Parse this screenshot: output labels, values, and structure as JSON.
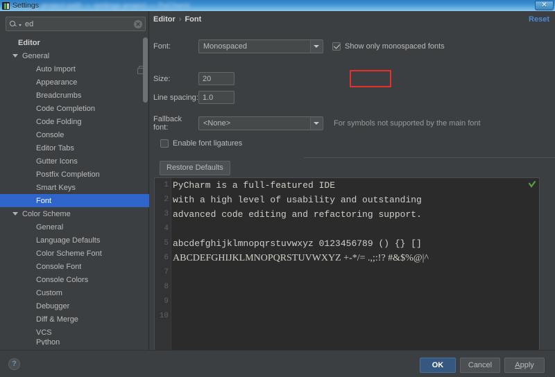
{
  "window": {
    "title": "Settings",
    "title_extra": "project path — settings project — PyCharm",
    "close_label": "✕",
    "icon": "pycharm-icon"
  },
  "sidebar": {
    "search": {
      "value": "ed",
      "placeholder": "",
      "clear_label": "✕"
    },
    "tree": [
      {
        "label": "Editor",
        "level": 0,
        "expander": false,
        "selected": false,
        "badge": false
      },
      {
        "label": "General",
        "level": 1,
        "expander": true,
        "selected": false,
        "badge": false
      },
      {
        "label": "Auto Import",
        "level": 2,
        "expander": false,
        "selected": false,
        "badge": true
      },
      {
        "label": "Appearance",
        "level": 2,
        "expander": false,
        "selected": false,
        "badge": false
      },
      {
        "label": "Breadcrumbs",
        "level": 2,
        "expander": false,
        "selected": false,
        "badge": false
      },
      {
        "label": "Code Completion",
        "level": 2,
        "expander": false,
        "selected": false,
        "badge": false
      },
      {
        "label": "Code Folding",
        "level": 2,
        "expander": false,
        "selected": false,
        "badge": false
      },
      {
        "label": "Console",
        "level": 2,
        "expander": false,
        "selected": false,
        "badge": false
      },
      {
        "label": "Editor Tabs",
        "level": 2,
        "expander": false,
        "selected": false,
        "badge": false
      },
      {
        "label": "Gutter Icons",
        "level": 2,
        "expander": false,
        "selected": false,
        "badge": false
      },
      {
        "label": "Postfix Completion",
        "level": 2,
        "expander": false,
        "selected": false,
        "badge": false
      },
      {
        "label": "Smart Keys",
        "level": 2,
        "expander": false,
        "selected": false,
        "badge": false
      },
      {
        "label": "Font",
        "level": 2,
        "expander": false,
        "selected": true,
        "badge": false
      },
      {
        "label": "Color Scheme",
        "level": 1,
        "expander": true,
        "selected": false,
        "badge": false
      },
      {
        "label": "General",
        "level": 2,
        "expander": false,
        "selected": false,
        "badge": false
      },
      {
        "label": "Language Defaults",
        "level": 2,
        "expander": false,
        "selected": false,
        "badge": false
      },
      {
        "label": "Color Scheme Font",
        "level": 2,
        "expander": false,
        "selected": false,
        "badge": false
      },
      {
        "label": "Console Font",
        "level": 2,
        "expander": false,
        "selected": false,
        "badge": false
      },
      {
        "label": "Console Colors",
        "level": 2,
        "expander": false,
        "selected": false,
        "badge": false
      },
      {
        "label": "Custom",
        "level": 2,
        "expander": false,
        "selected": false,
        "badge": false
      },
      {
        "label": "Debugger",
        "level": 2,
        "expander": false,
        "selected": false,
        "badge": false
      },
      {
        "label": "Diff & Merge",
        "level": 2,
        "expander": false,
        "selected": false,
        "badge": false
      },
      {
        "label": "VCS",
        "level": 2,
        "expander": false,
        "selected": false,
        "badge": false
      },
      {
        "label": "Python",
        "level": 2,
        "expander": false,
        "selected": false,
        "badge": false
      }
    ]
  },
  "main": {
    "breadcrumb": {
      "parent": "Editor",
      "separator": "›",
      "current": "Font"
    },
    "reset_label": "Reset",
    "font": {
      "label": "Font:",
      "value": "Monospaced",
      "monospaced_checkbox_label": "Show only monospaced fonts",
      "monospaced_checked": true
    },
    "size": {
      "label": "Size:",
      "value": "20",
      "highlight_color": "#e8302a"
    },
    "line_spacing": {
      "label": "Line spacing:",
      "value": "1.0"
    },
    "fallback": {
      "label": "Fallback font:",
      "value": "<None>",
      "hint": "For symbols not supported by the main font"
    },
    "ligatures": {
      "label": "Enable font ligatures",
      "checked": false
    },
    "restore_defaults_label": "Restore Defaults",
    "preview": {
      "line_numbers": [
        "1",
        "2",
        "3",
        "4",
        "5",
        "6",
        "7",
        "8",
        "9",
        "10"
      ],
      "lines": [
        "PyCharm is a full-featured IDE",
        "with a high level of usability and outstanding",
        "advanced code editing and refactoring support.",
        "",
        "abcdefghijklmnopqrstuvwxyz 0123456789 () {} []",
        "ABCDEFGHIJKLMNOPQRSTUVWXYZ +-*/= .,;:!? #&$%@|^",
        "",
        "",
        "",
        ""
      ],
      "status_icon": "green-check-icon"
    }
  },
  "footer": {
    "help_label": "?",
    "ok_label": "OK",
    "cancel_label": "Cancel",
    "apply_label": "Apply",
    "apply_mnemonic": "A",
    "apply_rest": "pply"
  },
  "colors": {
    "background": "#3c3f41",
    "selection": "#2f65ca",
    "accent_link": "#4d87d6",
    "primary_button": "#365880",
    "editor_background": "#2b2b2b",
    "highlight": "#e8302a"
  }
}
